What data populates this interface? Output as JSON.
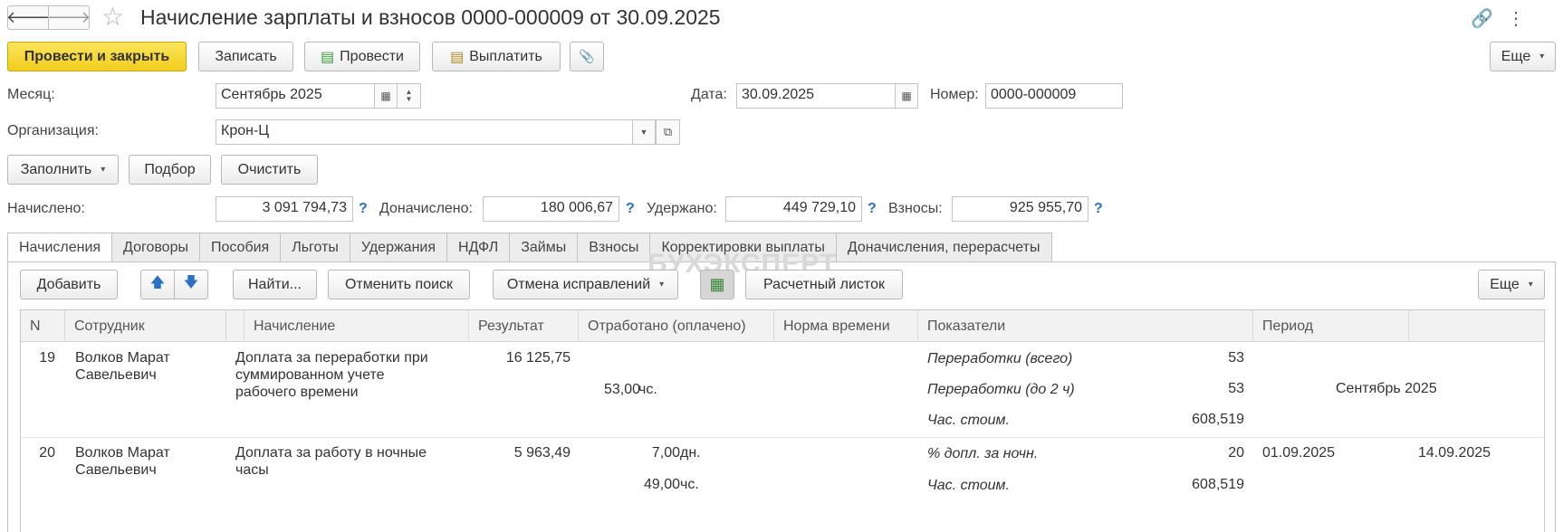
{
  "header": {
    "title": "Начисление зарплаты и взносов 0000-000009 от 30.09.2025",
    "back_icon": "arrow-left-icon",
    "forward_icon": "arrow-right-icon",
    "star_icon": "star-icon",
    "link_icon": "link-icon",
    "menu_icon": "kebab-menu-icon",
    "back_glyph": "🡐",
    "forward_glyph": "🡒",
    "star_glyph": "☆",
    "link_glyph": "🔗",
    "menu_glyph": "⋮"
  },
  "toolbar": {
    "post_close_label": "Провести и закрыть",
    "save_label": "Записать",
    "post_label": "Провести",
    "pay_label": "Выплатить",
    "attach_icon": "paperclip-icon",
    "attach_glyph": "📎",
    "more_label": "Еще"
  },
  "form": {
    "month_label": "Месяц:",
    "month_value": "Сентябрь 2025",
    "date_label": "Дата:",
    "date_value": "30.09.2025",
    "number_label": "Номер:",
    "number_value": "0000-000009",
    "org_label": "Организация:",
    "org_value": "Крон-Ц"
  },
  "actions": {
    "fill_label": "Заполнить",
    "select_label": "Подбор",
    "clear_label": "Очистить"
  },
  "totals": {
    "accrued_label": "Начислено:",
    "accrued_value": "3 091 794,73",
    "additional_label": "Доначислено:",
    "additional_value": "180 006,67",
    "withheld_label": "Удержано:",
    "withheld_value": "449 729,10",
    "contributions_label": "Взносы:",
    "contributions_value": "925 955,70",
    "help_mark": "?"
  },
  "tabs": [
    {
      "label": "Начисления",
      "active": true
    },
    {
      "label": "Договоры"
    },
    {
      "label": "Пособия"
    },
    {
      "label": "Льготы"
    },
    {
      "label": "Удержания"
    },
    {
      "label": "НДФЛ"
    },
    {
      "label": "Займы"
    },
    {
      "label": "Взносы"
    },
    {
      "label": "Корректировки выплаты"
    },
    {
      "label": "Доначисления, перерасчеты"
    }
  ],
  "watermark": "БУХЭКСПЕРТ",
  "table_toolbar": {
    "add_label": "Добавить",
    "up_icon": "arrow-up-icon",
    "down_icon": "arrow-down-icon",
    "up_glyph": "🡅",
    "down_glyph": "🡇",
    "find_label": "Найти...",
    "cancel_search_label": "Отменить поиск",
    "cancel_fix_label": "Отмена исправлений",
    "table_icon": "table-edit-icon",
    "table_glyph": "▦",
    "payslip_label": "Расчетный листок",
    "more_label": "Еще"
  },
  "table": {
    "columns": [
      "N",
      "Сотрудник",
      "",
      "Начисление",
      "Результат",
      "Отработано (оплачено)",
      "Норма времени",
      "Показатели",
      "Период",
      ""
    ],
    "rows": [
      {
        "n": "19",
        "employee_1": "Волков Марат",
        "employee_2": "Савельевич",
        "accrual_1": "Доплата за переработки при",
        "accrual_2": "суммированном учете",
        "accrual_3": "рабочего времени",
        "result": "16 125,75",
        "worked_1": "53,00",
        "unit_1": "чс.",
        "ind_1_name": "Переработки (всего)",
        "ind_1_value": "53",
        "ind_2_name": "Переработки (до 2 ч)",
        "ind_2_value": "53",
        "ind_3_name": "Час. стоим.",
        "ind_3_value": "608,519",
        "period": "Сентябрь 2025"
      },
      {
        "n": "20",
        "employee_1": "Волков Марат",
        "employee_2": "Савельевич",
        "accrual_1": "Доплата за работу в ночные",
        "accrual_2": "часы",
        "result": "5 963,49",
        "worked_1": "7,00",
        "unit_1": "дн.",
        "worked_2": "49,00",
        "unit_2": "чс.",
        "ind_1_name": "% допл. за ночн.",
        "ind_1_value": "20",
        "ind_2_name": "Час. стоим.",
        "ind_2_value": "608,519",
        "period_from": "01.09.2025",
        "period_to": "14.09.2025"
      }
    ]
  }
}
